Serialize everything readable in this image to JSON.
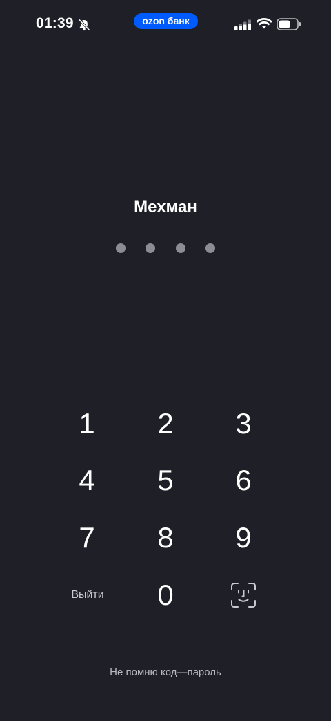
{
  "status_bar": {
    "time": "01:39",
    "brand": "ozon банк",
    "icons": [
      "bell-slash-icon",
      "cellular-signal-icon",
      "wifi-icon",
      "battery-icon"
    ]
  },
  "lock_screen": {
    "user_name": "Мехман",
    "pin_length": 4,
    "pin_entered": 0
  },
  "keypad": {
    "keys": [
      "1",
      "2",
      "3",
      "4",
      "5",
      "6",
      "7",
      "8",
      "9",
      "0"
    ],
    "logout_label": "Выйти",
    "biometric_icon": "face-id-icon"
  },
  "footer": {
    "forgot_passcode": "Не помню код—пароль"
  },
  "colors": {
    "background": "#1f2027",
    "brand_blue": "#005bff",
    "dot_inactive": "#8c8d93"
  }
}
